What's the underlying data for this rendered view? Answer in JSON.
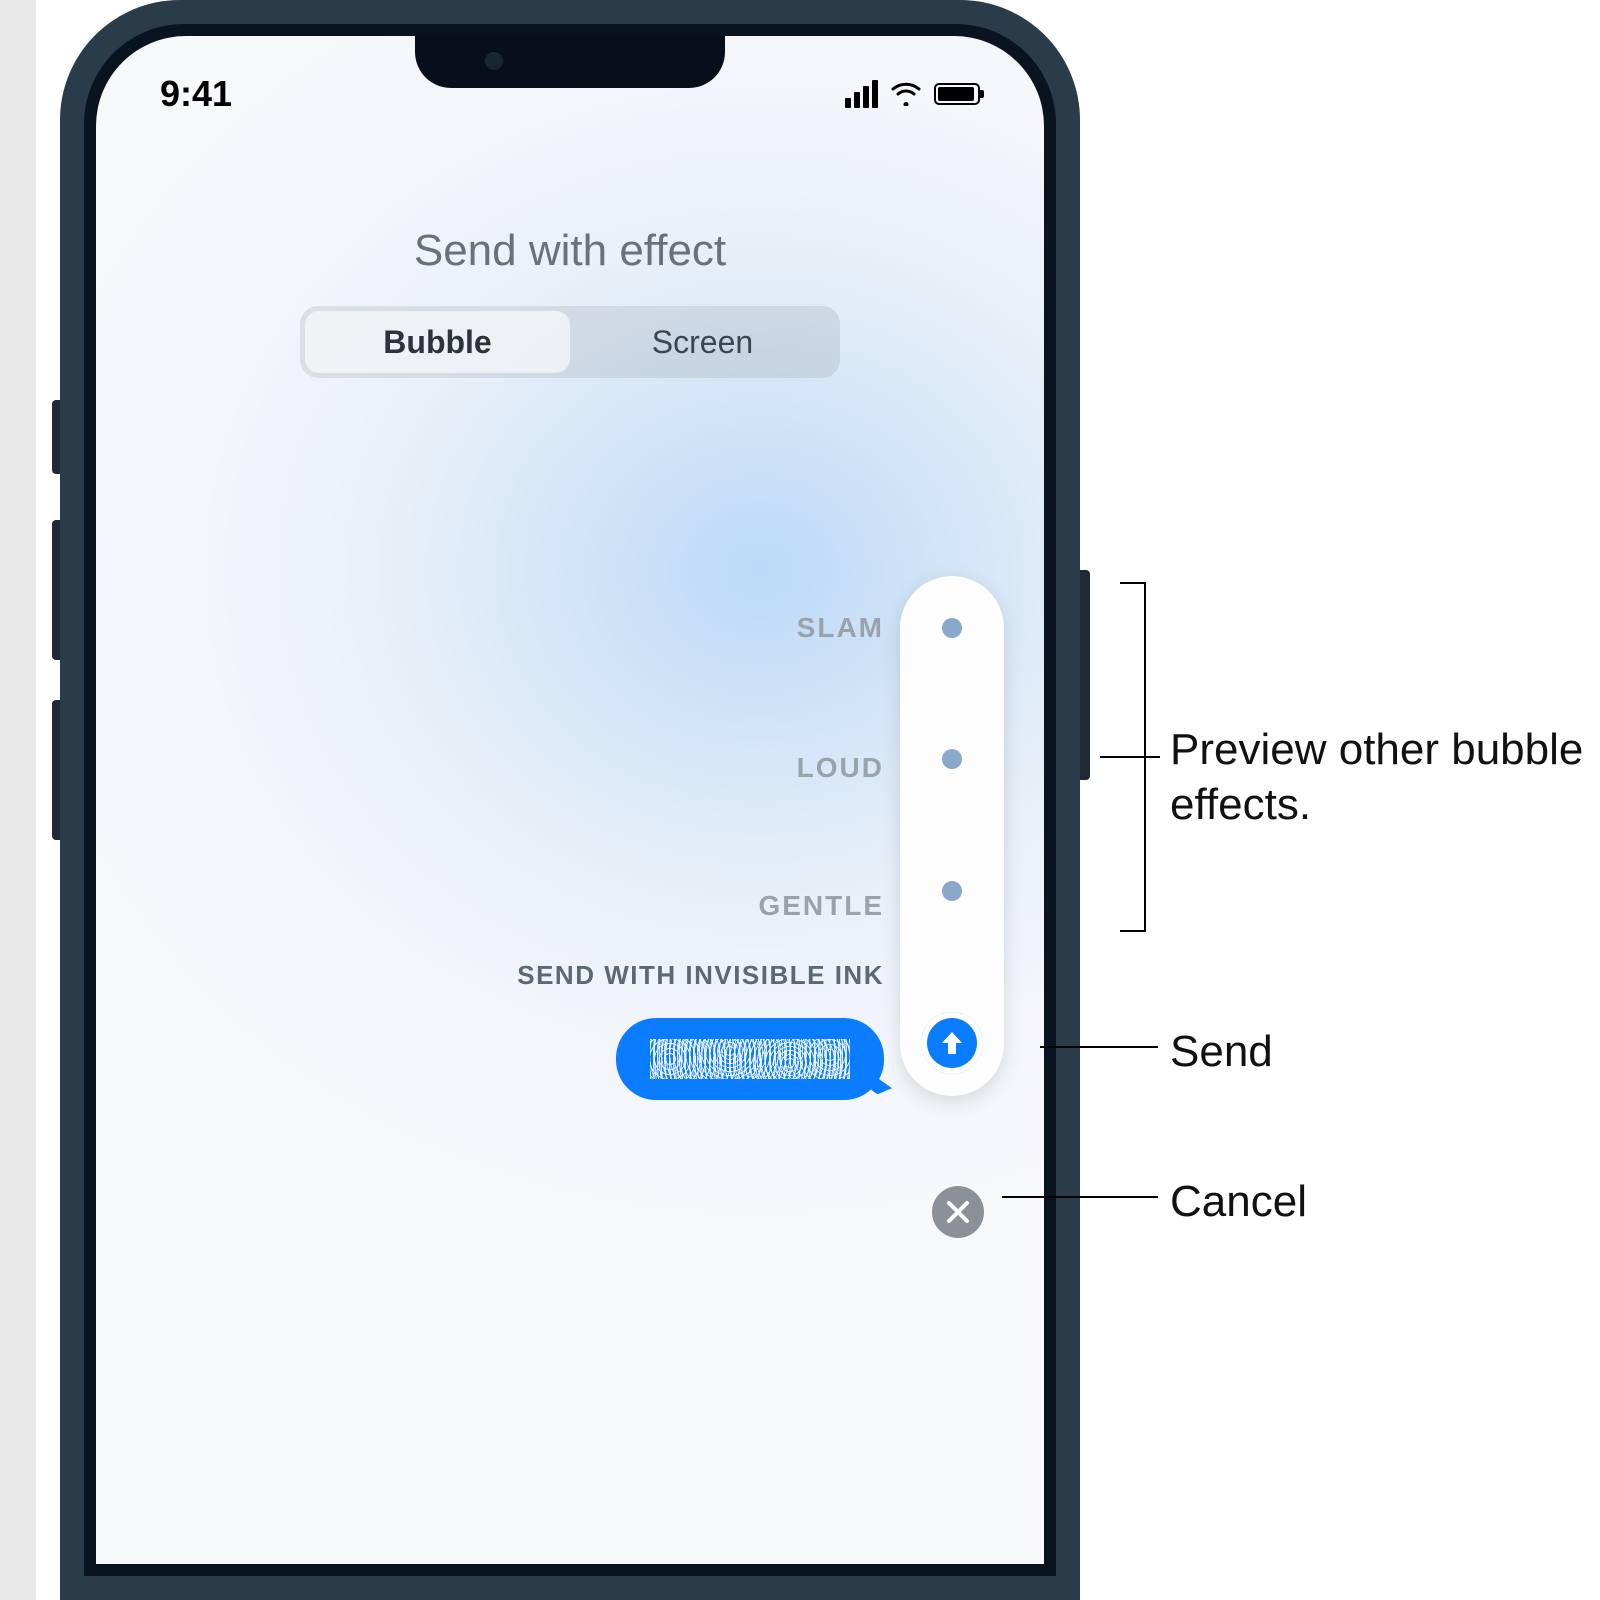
{
  "status": {
    "time": "9:41"
  },
  "header": {
    "title": "Send with effect"
  },
  "tabs": {
    "bubble": "Bubble",
    "screen": "Screen"
  },
  "effects": {
    "slam": "SLAM",
    "loud": "LOUD",
    "gentle": "GENTLE",
    "invisible_ink": "SEND WITH INVISIBLE INK"
  },
  "callouts": {
    "preview": "Preview other bubble effects.",
    "send": "Send",
    "cancel": "Cancel"
  }
}
